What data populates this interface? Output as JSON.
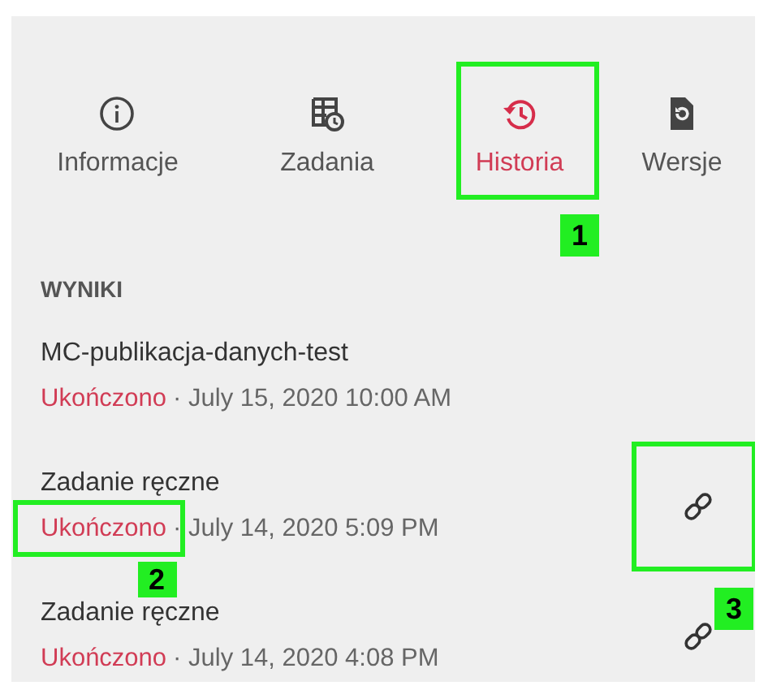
{
  "tabs": [
    {
      "label": "Informacje",
      "kind": "info",
      "selected": false
    },
    {
      "label": "Zadania",
      "kind": "tasks",
      "selected": false
    },
    {
      "label": "Historia",
      "kind": "history",
      "selected": true,
      "callout": "1"
    },
    {
      "label": "Wersje",
      "kind": "versions",
      "selected": false
    }
  ],
  "results": {
    "heading": "WYNIKI",
    "items": [
      {
        "name": "MC-publikacja-danych-test",
        "status": "Ukończono",
        "time": "· July 15, 2020 10:00 AM",
        "link": false
      },
      {
        "name": "Zadanie ręczne",
        "status": "Ukończono",
        "time": "· July 14, 2020 5:09 PM",
        "link": true,
        "status_callout": "2",
        "link_callout": "3"
      },
      {
        "name": "Zadanie ręczne",
        "status": "Ukończono",
        "time": "· July 14, 2020 4:08 PM",
        "link": true
      }
    ]
  }
}
